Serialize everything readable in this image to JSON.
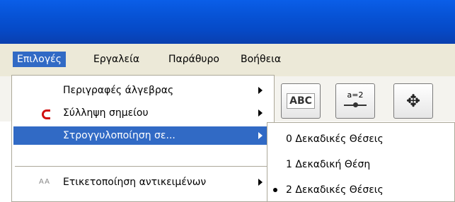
{
  "menubar": {
    "items": [
      {
        "label": "Επιλογές",
        "active": true
      },
      {
        "label": "Εργαλεία"
      },
      {
        "label": "Παράθυρο"
      },
      {
        "label": "Βοήθεια"
      }
    ]
  },
  "toolbar": {
    "buttons": [
      {
        "label": "ABC",
        "icon": "text-tool-icon"
      },
      {
        "label": "a=2",
        "icon": "slider-tool-icon"
      },
      {
        "label": "",
        "icon": "move-tool-icon"
      }
    ]
  },
  "options_menu": {
    "items": [
      {
        "label": "Περιγραφές άλγεβρας",
        "has_submenu": true
      },
      {
        "label": "Σύλληψη σημείου",
        "has_submenu": true,
        "icon": "magnet-icon"
      },
      {
        "label": "Στρογγυλοποίηση σε...",
        "has_submenu": true,
        "highlighted": true
      },
      {
        "label": "Ετικετοποίηση αντικειμένων",
        "has_submenu": true,
        "icon": "aa-icon",
        "icon_text": "AA"
      }
    ]
  },
  "rounding_submenu": {
    "items": [
      {
        "label": "0 Δεκαδικές Θέσεις",
        "selected": false
      },
      {
        "label": "1 Δεκαδική Θέση",
        "selected": false
      },
      {
        "label": "2 Δεκαδικές Θέσεις",
        "selected": true
      }
    ]
  },
  "colors": {
    "highlight": "#316ac5",
    "titlebar": "#0a5ee8",
    "magnet": "#d01010"
  }
}
